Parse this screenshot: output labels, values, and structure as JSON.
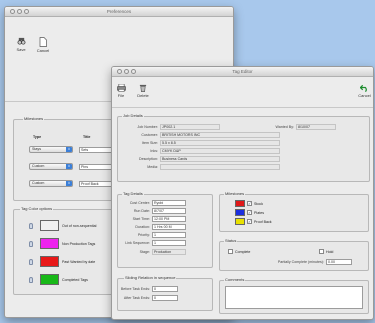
{
  "prefs": {
    "title": "Preferences",
    "toolbar": {
      "save": "Save",
      "cancel": "Cancel"
    },
    "milestones": {
      "legend": "Milestones",
      "type_header": "Type",
      "title_header": "Title",
      "rows": [
        {
          "type": "Stays",
          "title": "Sets"
        },
        {
          "type": "Custom",
          "title": "Pins"
        },
        {
          "type": "Custom",
          "title": "Proof Back"
        }
      ]
    },
    "tags": {
      "legend": "Tag Color options",
      "rows": [
        {
          "label": "Out of non-sequential",
          "color": "#f0f0f0"
        },
        {
          "label": "Non Production Tags",
          "color": "#ee22ee"
        },
        {
          "label": "Past Wanted by date",
          "color": "#e81818"
        },
        {
          "label": "Completed Tags",
          "color": "#18b818"
        }
      ]
    }
  },
  "editor": {
    "title": "Tag Editor",
    "toolbar": {
      "file": "File",
      "delete": "Delete",
      "cancel": "Cancel"
    },
    "job": {
      "legend": "Job Details",
      "job_number_label": "Job Number:",
      "job_number": "JP002.1",
      "customer_label": "Customer:",
      "customer": "BRITISH MOTORS INC",
      "item_size_label": "Item Size:",
      "item_size": "5.5 x 8.5",
      "inks_label": "Inks:",
      "inks": "CMYK D&P",
      "description_label": "Description:",
      "description": "Business Cards",
      "media_label": "Media:",
      "media": "",
      "wanted_label": "Wanted By:",
      "wanted": "8/10/07"
    },
    "tag": {
      "legend": "Tag Details",
      "cost_center_label": "Cost Center:",
      "cost_center": "Ryobi",
      "run_date_label": "Run Date:",
      "run_date": "8/7/07",
      "start_time_label": "Start Time:",
      "start_time": "12:00 PM",
      "duration_label": "Duration:",
      "duration": "1 Hrs 00 M",
      "priority_label": "Priority:",
      "priority": "1",
      "link_sequence_label": "Link Sequence:",
      "link_sequence": "1",
      "stage_label": "Stage:",
      "stage": "Production"
    },
    "sliding": {
      "legend": "Sliding Relation in sequence",
      "before_label": "Before Task Ends:",
      "before": "0",
      "after_label": "After Task Ends:",
      "after": "0"
    },
    "milestones": {
      "legend": "Milestones",
      "items": [
        {
          "label": "Stock",
          "color": "#e01818",
          "checked": "✓"
        },
        {
          "label": "Plates",
          "color": "#1a2ee0",
          "checked": "✓"
        },
        {
          "label": "Proof Back",
          "color": "#e8e000",
          "checked": "✓"
        }
      ]
    },
    "status": {
      "legend": "Status",
      "complete": "Complete",
      "hold": "Hold",
      "partial_label": "Partially Complete (minutes):",
      "partial": "0.00"
    },
    "comments": {
      "legend": "Comments",
      "text": ""
    }
  }
}
